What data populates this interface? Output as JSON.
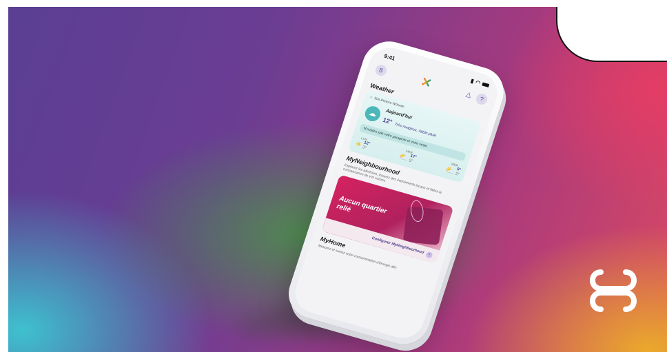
{
  "phone": {
    "status_time": "9:41",
    "weather": {
      "section_title": "Weather",
      "location": "Sint-Pieters-Woluwe",
      "today_label": "Aujourd'hui",
      "today_temp": "12°",
      "today_desc": "Très nuageux, faible pluie",
      "tip": "N'oubliez pas votre parapluie et votre veste",
      "forecast": [
        {
          "day": "LUN",
          "high": "12°",
          "low": "3°"
        },
        {
          "day": "MAR",
          "high": "17°",
          "low": "5°"
        },
        {
          "day": "MER",
          "high": "9°",
          "low": "2°"
        }
      ]
    },
    "neighbourhood": {
      "section_title": "MyNeighbourhood",
      "description": "Explorez les alentours, trouvez des événements locaux et faites la connaissance de vos voisins.",
      "card_title": "Aucun quartier relié",
      "link_label": "Configurer MyNeighbourhood"
    },
    "home": {
      "section_title": "MyHome",
      "description": "Mesurez et suivez votre consommation d'énergie afin"
    }
  },
  "colors": {
    "accent_purple": "#4c3e8f",
    "weather_teal": "#4bb7b8",
    "hood_pink": "#d4235f"
  }
}
